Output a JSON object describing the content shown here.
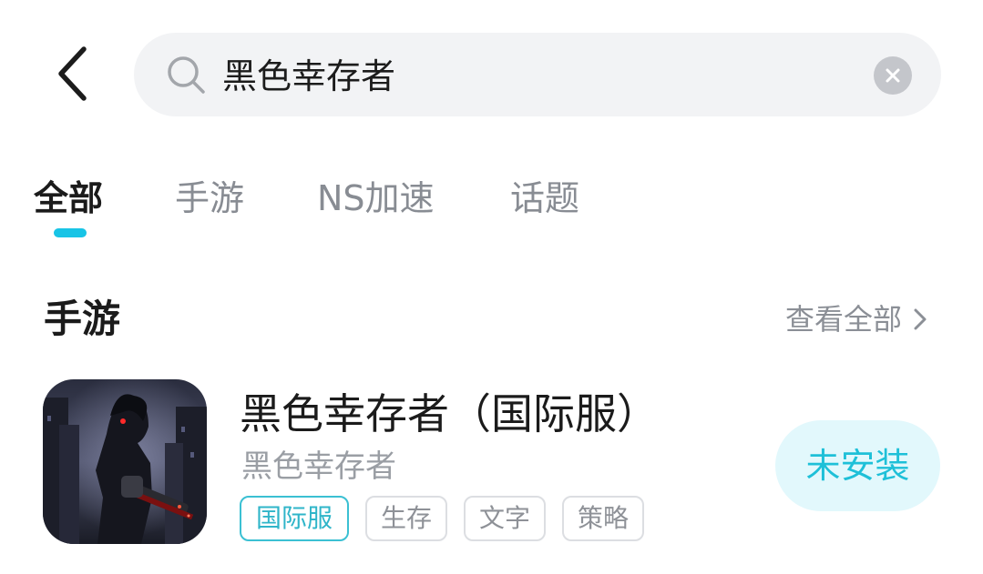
{
  "header": {
    "back_icon": "chevron-left-icon",
    "search": {
      "icon": "search-icon",
      "value": "黑色幸存者",
      "clear_icon": "clear-icon"
    }
  },
  "tabs": [
    {
      "label": "全部",
      "active": true
    },
    {
      "label": "手游",
      "active": false
    },
    {
      "label": "NS加速",
      "active": false
    },
    {
      "label": "话题",
      "active": false
    }
  ],
  "colors": {
    "accent": "#18c4e6",
    "install_bg": "#e2f8fc",
    "install_text": "#1ec0d8"
  },
  "section": {
    "title": "手游",
    "view_all": "查看全部"
  },
  "game": {
    "title": "黑色幸存者（国际服）",
    "subtitle": "黑色幸存者",
    "tags": [
      "国际服",
      "生存",
      "文字",
      "策略"
    ],
    "install_label": "未安装"
  }
}
